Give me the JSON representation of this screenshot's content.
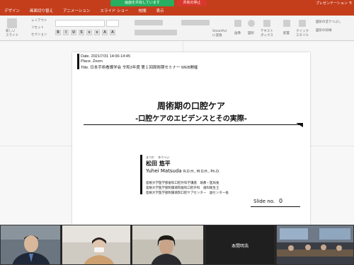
{
  "titlebar": {
    "share_banner": "画面を共有しています",
    "stop_share": "共有の停止",
    "presenter_view": "プレゼンテーション モード"
  },
  "tabs": [
    "デザイン",
    "画面切り替え",
    "アニメーション",
    "スライド ショー",
    "校閲",
    "表示"
  ],
  "ribbon": {
    "new_slide": "新しい\nスライド",
    "layout": "レイアウト",
    "reset": "リセット",
    "section": "セクション",
    "smartart": "SmartArt\nに変換",
    "picture": "画像",
    "shape": "図形",
    "textbox": "テキスト\nボックス",
    "arrange": "配置",
    "quick_styles": "クイック\nスタイル",
    "fill": "図形の塗りつぶし",
    "outline": "図形の枠線"
  },
  "slide": {
    "date": "Date.   2021/7/31  14:00-14:45",
    "place": "Place.  Zoom",
    "title_line": "Title.   日本手術看護学会 令和3年度 第１回周術期セミナー WEB開催",
    "title": "周術期の口腔ケア",
    "subtitle": "-口腔ケアのエビデンスとその実際-",
    "presenter_ruby": "まつだ　 ゆうへい",
    "presenter_name": "松田 悠平",
    "presenter_roman": "Yuhei Matsuda ",
    "presenter_cred": "R.D.H., M.O.H., Ph.D.",
    "affiliations": [
      "島根大学医学部歯科口腔外科学講座　助教・医局長",
      "島根大学医学部附属病院歯科口腔外科　歯科衛生士",
      "島根大学医学部附属病院口腔ケアセンター　副センター長"
    ],
    "slide_no_label": "Slide no.",
    "slide_no_value": "0"
  },
  "videos": {
    "tile4_label": "本間明浩"
  }
}
